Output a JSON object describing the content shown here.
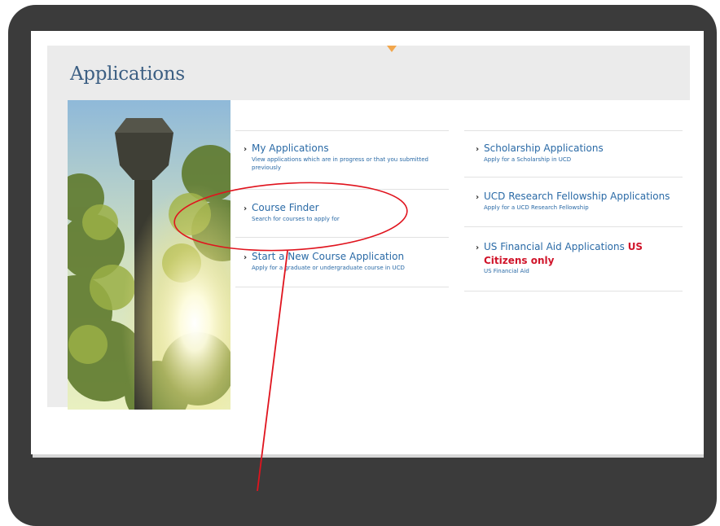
{
  "header": {
    "title": "Applications"
  },
  "left_column": [
    {
      "title": "My Applications",
      "description": "View applications which are in progress or that you submitted previously"
    },
    {
      "title": "Course Finder",
      "description": "Search for courses to apply for"
    },
    {
      "title": "Start a New Course Application",
      "description": "Apply for a graduate or undergraduate course in UCD"
    }
  ],
  "right_column": [
    {
      "title": "Scholarship Applications",
      "description": "Apply for a Scholarship in UCD"
    },
    {
      "title": "UCD Research Fellowship Applications",
      "description": "Apply for a UCD Research Fellowship"
    },
    {
      "title": "US Financial Aid Applications",
      "highlight_suffix": "US",
      "highlight_line": "Citizens only",
      "description": "US Financial Aid"
    }
  ],
  "colors": {
    "link": "#2a6aa6",
    "title": "#3c5f83",
    "highlight": "#d0142a",
    "annotation": "#e0141e"
  }
}
